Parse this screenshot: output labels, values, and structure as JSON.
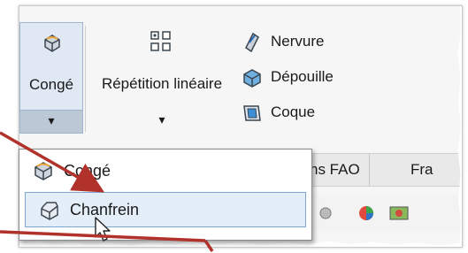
{
  "ribbon": {
    "conge_label": "Congé",
    "conge_dropdown": "▾",
    "repetition_label": "Répétition linéaire",
    "repetition_dropdown": "▾",
    "nervure_label": "Nervure",
    "depouille_label": "Dépouille",
    "coque_label": "Coque"
  },
  "tabs": [
    {
      "label": "ns FAO"
    },
    {
      "label": "Fra"
    }
  ],
  "menu": {
    "items": [
      {
        "label": "Congé"
      },
      {
        "label": "Chanfrein"
      }
    ]
  },
  "colors": {
    "hover_bg": "#e3eef9",
    "hover_border": "#7fa6d0",
    "arrow": "#b0322b"
  },
  "icons": [
    "fillet-icon",
    "linear-pattern-icon",
    "rib-icon",
    "draft-icon",
    "shell-icon",
    "chamfer-icon",
    "cursor-icon"
  ]
}
